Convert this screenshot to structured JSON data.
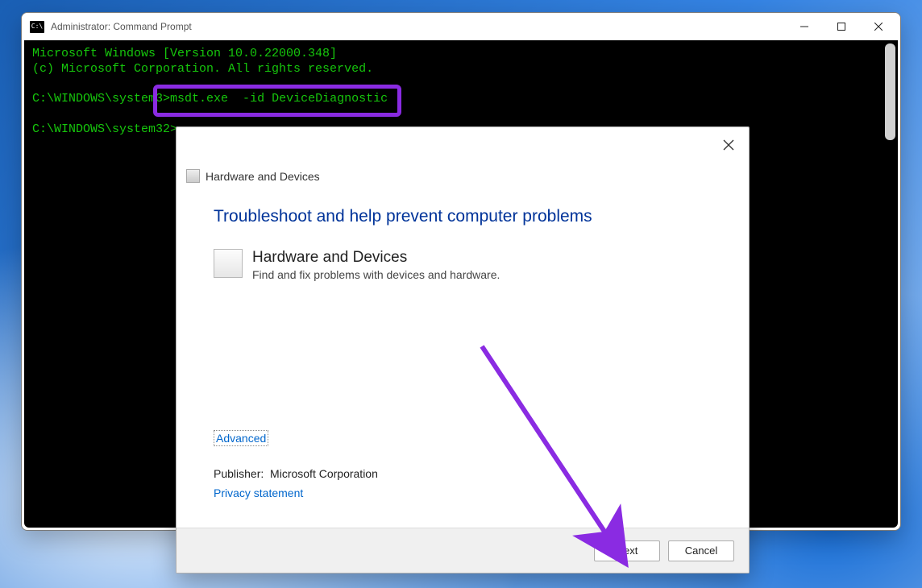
{
  "cmd": {
    "title": "Administrator: Command Prompt",
    "line1": "Microsoft Windows [Version 10.0.22000.348]",
    "line2": "(c) Microsoft Corporation. All rights reserved.",
    "prompt1_prefix": "C:\\WINDOWS\\system3",
    "prompt1_cmd_gt": ">",
    "prompt1_cmd": "msdt.exe  -id DeviceDiagnostic",
    "prompt2": "C:\\WINDOWS\\system32>"
  },
  "dialog": {
    "header": "Hardware and Devices",
    "heading": "Troubleshoot and help prevent computer problems",
    "subtitle": "Hardware and Devices",
    "description": "Find and fix problems with devices and hardware.",
    "advanced": "Advanced",
    "publisher_label": "Publisher:",
    "publisher_value": "Microsoft Corporation",
    "privacy": "Privacy statement",
    "next_prefix": "N",
    "next_rest": "ext",
    "cancel": "Cancel"
  }
}
